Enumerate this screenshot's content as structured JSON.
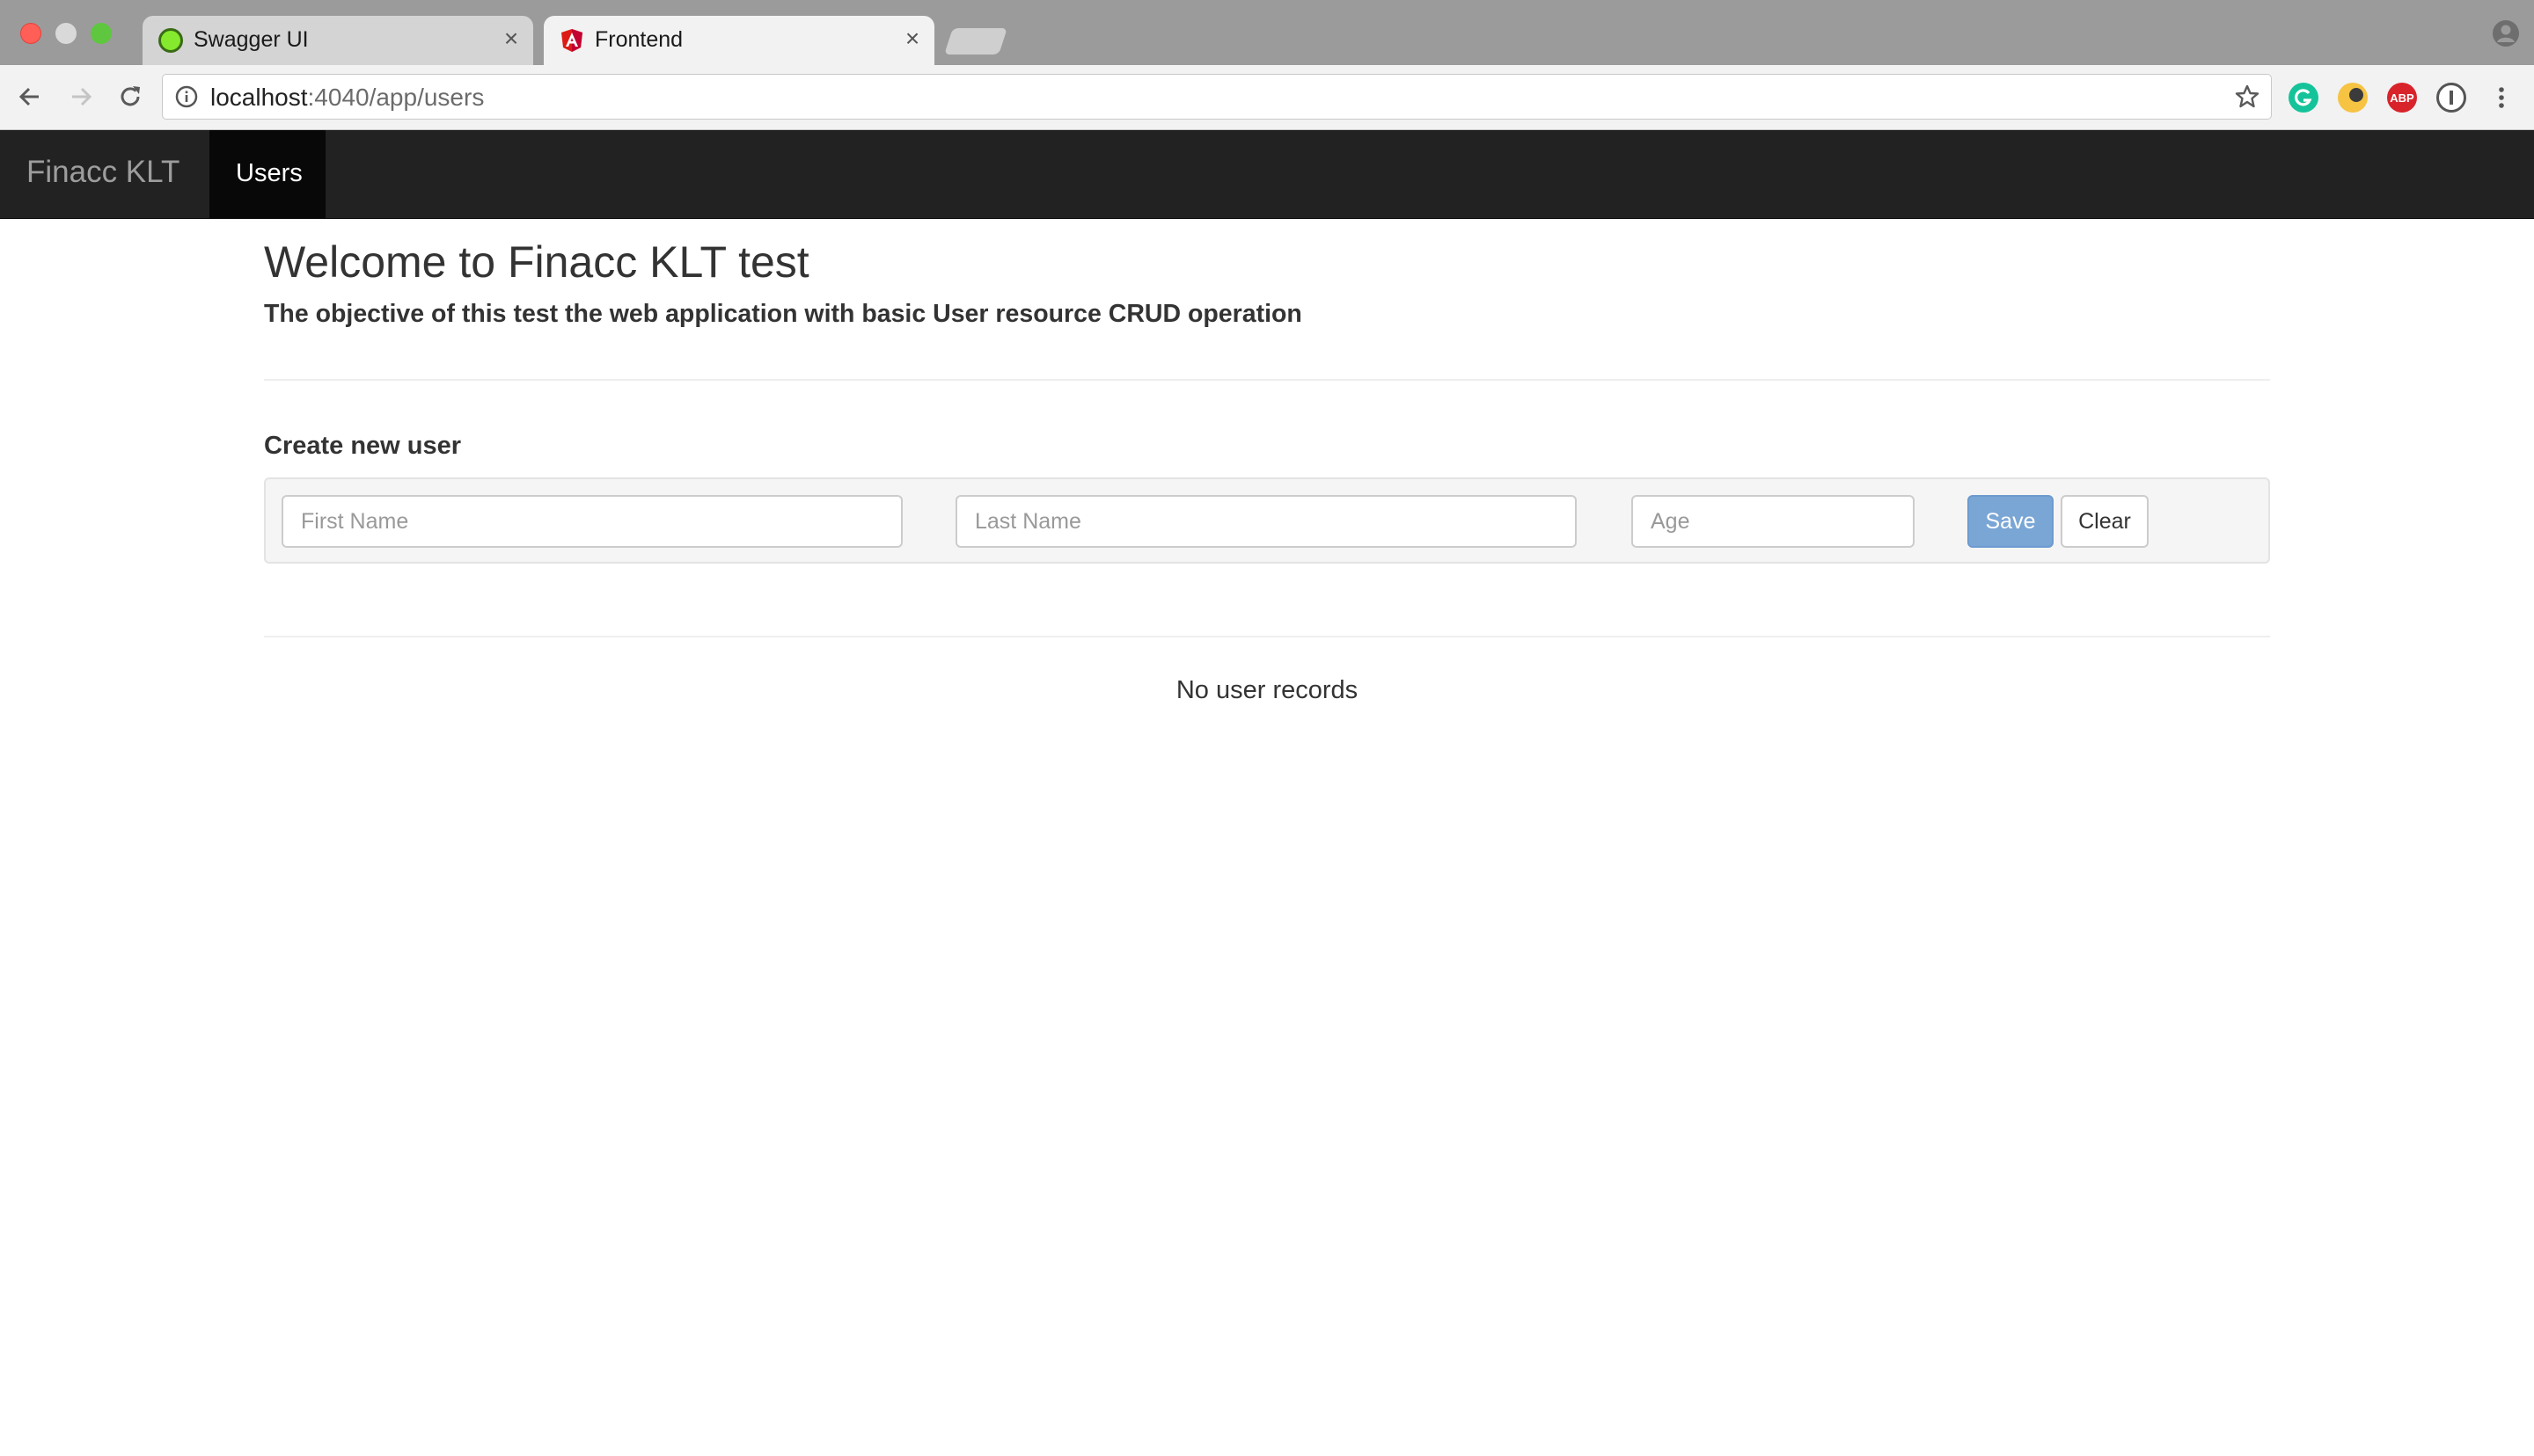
{
  "browser": {
    "tabs": [
      {
        "title": "Swagger UI",
        "icon": "swagger-favicon",
        "active": false
      },
      {
        "title": "Frontend",
        "icon": "angular-favicon",
        "active": true
      }
    ],
    "tab_close_glyph": "×",
    "address_bar": {
      "host": "localhost",
      "path": ":4040/app/users"
    },
    "extensions": [
      "grammarly-icon",
      "dark-mode-icon",
      "adblock-plus-icon",
      "onepassword-icon"
    ],
    "abp_label": "ABP"
  },
  "navbar": {
    "brand": "Finacc KLT",
    "items": [
      {
        "label": "Users",
        "active": true
      }
    ]
  },
  "main": {
    "title": "Welcome to Finacc KLT test",
    "lead": "The objective of this test the web application with basic User resource CRUD operation",
    "form": {
      "heading": "Create new user",
      "first_name": {
        "placeholder": "First Name",
        "value": ""
      },
      "last_name": {
        "placeholder": "Last Name",
        "value": ""
      },
      "age": {
        "placeholder": "Age",
        "value": ""
      },
      "save_label": "Save",
      "clear_label": "Clear"
    },
    "empty_message": "No user records"
  },
  "colors": {
    "navbar_bg": "#222222",
    "navbar_active_bg": "#080808",
    "save_button": "#7aa6d5",
    "well_bg": "#f5f5f5"
  }
}
